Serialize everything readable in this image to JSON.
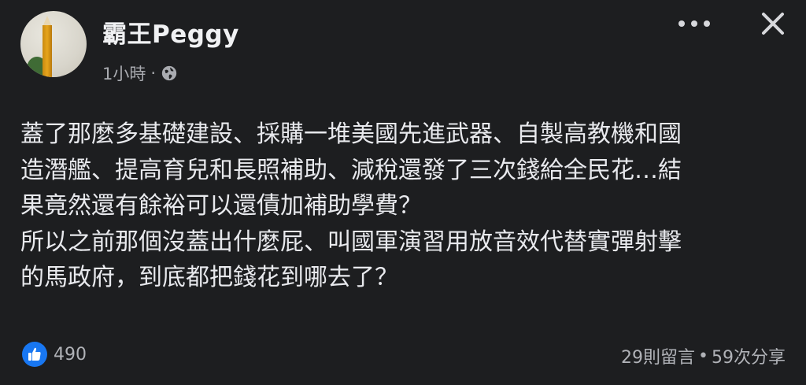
{
  "post": {
    "author": "霸王Peggy",
    "time": "1小時",
    "separator": "·",
    "body": "蓋了那麼多基礎建設、採購一堆美國先進武器、自製高教機和國\n造潛艦、提高育兒和長照補助、減稅還發了三次錢給全民花…結\n果竟然還有餘裕可以還債加補助學費？\n所以之前那個沒蓋出什麼屁、叫國軍演習用放音效代替實彈射擊\n的馬政府，到底都把錢花到哪去了？",
    "reactions_count": "490",
    "comments": "29則留言",
    "dot": "•",
    "shares": "59次分享"
  },
  "icons": {
    "privacy": "globe-icon",
    "more": "more-options-icon",
    "close": "close-icon",
    "reaction": "like-icon"
  },
  "colors": {
    "background": "#1d1e20",
    "like_blue": "#1877f2"
  }
}
